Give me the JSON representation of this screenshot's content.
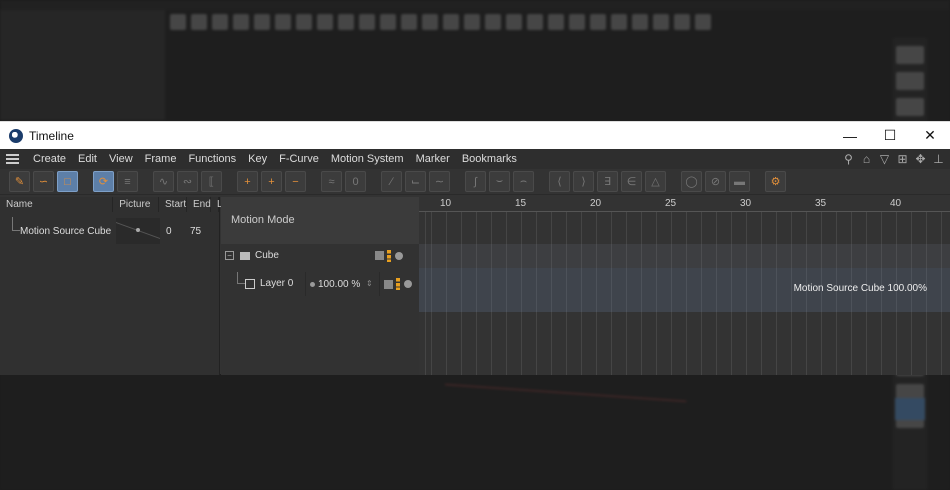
{
  "window": {
    "title": "Timeline",
    "controls": [
      "minimize",
      "maximize",
      "close"
    ]
  },
  "menu": {
    "items": [
      "Create",
      "Edit",
      "View",
      "Frame",
      "Functions",
      "Key",
      "F-Curve",
      "Motion System",
      "Marker",
      "Bookmarks"
    ]
  },
  "object_list": {
    "columns": [
      "Name",
      "Picture",
      "Start",
      "End",
      "L"
    ],
    "rows": [
      {
        "name": "Motion Source Cube",
        "start": "0",
        "end": "75"
      }
    ]
  },
  "motion_panel": {
    "header": "Motion Mode",
    "cube_label": "Cube",
    "layer_label": "Layer 0",
    "layer_strength": "100.00 %"
  },
  "ruler": {
    "ticks": [
      "10",
      "15",
      "20",
      "25",
      "30",
      "35",
      "40"
    ]
  },
  "track": {
    "caption": "Motion Source Cube  100.00%"
  },
  "colors": {
    "accent_orange": "#e3903a",
    "active_blue": "#5d7fa8",
    "titlebar": "#ffffff"
  }
}
